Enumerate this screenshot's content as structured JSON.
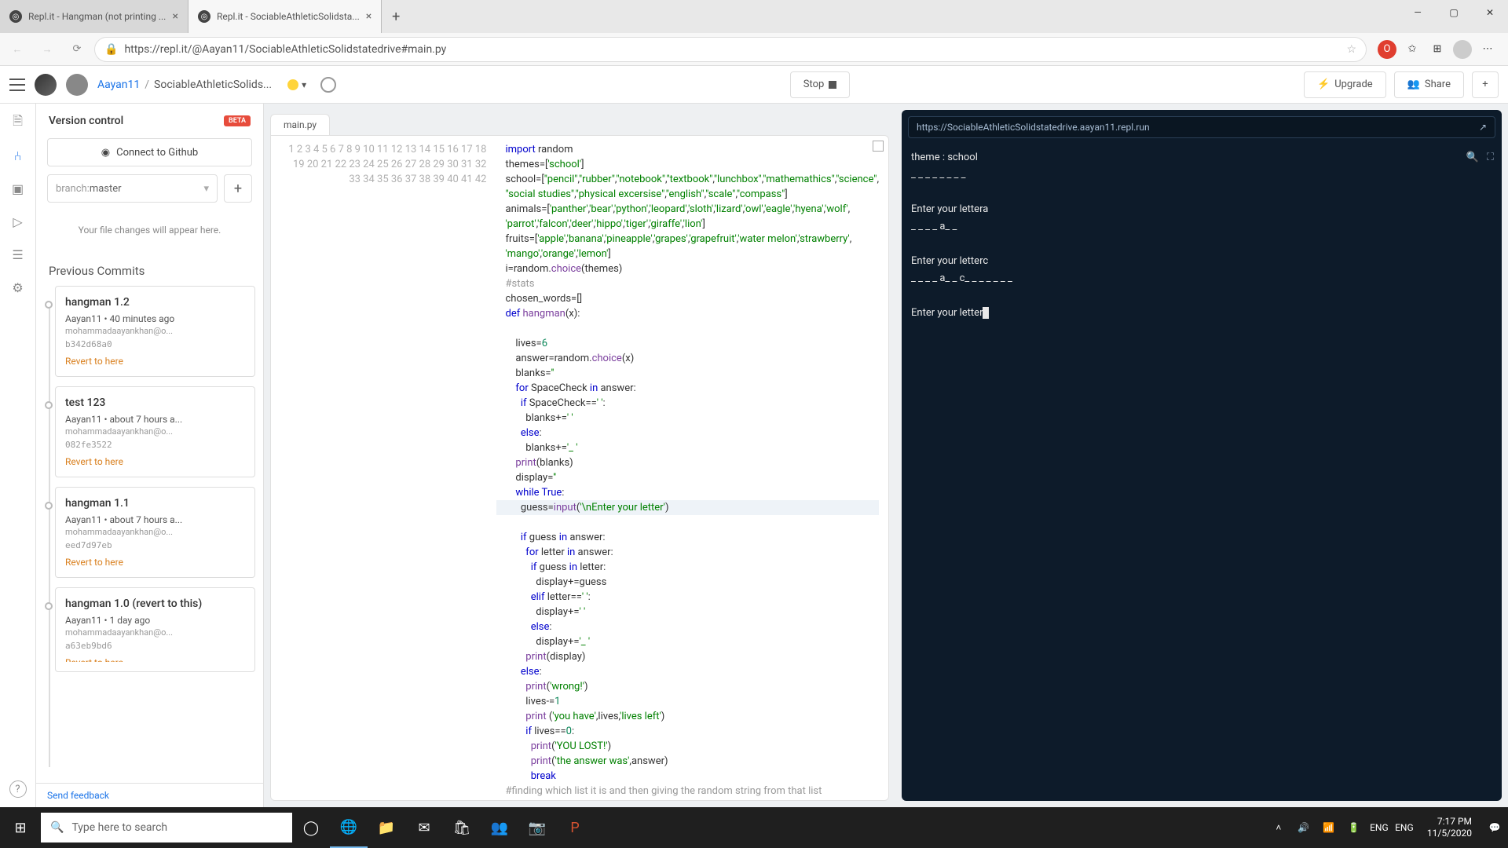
{
  "browser": {
    "tabs": [
      {
        "title": "Repl.it - Hangman (not printing ..."
      },
      {
        "title": "Repl.it - SociableAthleticSolidsta..."
      }
    ],
    "url": "https://repl.it/@Aayan11/SociableAthleticSolidstatedrive#main.py"
  },
  "app": {
    "user": "Aayan11",
    "project": "SociableAthleticSolids...",
    "stop": "Stop",
    "upgrade": "Upgrade",
    "share": "Share"
  },
  "vcs": {
    "title": "Version control",
    "beta": "BETA",
    "connect": "Connect to Github",
    "branch_label": "branch: ",
    "branch": "master",
    "changes_note": "Your file changes will appear here.",
    "prev": "Previous Commits",
    "revert": "Revert to here",
    "commits": [
      {
        "title": "hangman 1.2",
        "meta": "Aayan11 • 40 minutes ago",
        "email": "mohammadaayankhan@o...",
        "hash": "b342d68a0"
      },
      {
        "title": "test 123",
        "meta": "Aayan11 • about 7 hours a...",
        "email": "mohammadaayankhan@o...",
        "hash": "082fe3522"
      },
      {
        "title": "hangman 1.1",
        "meta": "Aayan11 • about 7 hours a...",
        "email": "mohammadaayankhan@o...",
        "hash": "eed7d97eb"
      },
      {
        "title": "hangman 1.0 (revert to this)",
        "meta": "Aayan11 • 1 day ago",
        "email": "mohammadaayankhan@o...",
        "hash": "a63eb9bd6"
      }
    ],
    "feedback": "Send feedback"
  },
  "editor": {
    "filename": "main.py"
  },
  "console": {
    "url": "https://SociableAthleticSolidstatedrive.aayan11.repl.run",
    "lines": [
      "theme : school",
      "_ _ _ _ _ _ _ _",
      "",
      "Enter your lettera",
      "_ _ _ _ a_ _",
      "",
      "Enter your letterc",
      "_ _ _ _ a_ _ c_ _ _ _ _ _ _",
      "",
      "Enter your letter"
    ]
  },
  "taskbar": {
    "search": "Type here to search",
    "lang": "ENG",
    "ime": "ENG",
    "time": "7:17 PM",
    "date": "11/5/2020"
  }
}
